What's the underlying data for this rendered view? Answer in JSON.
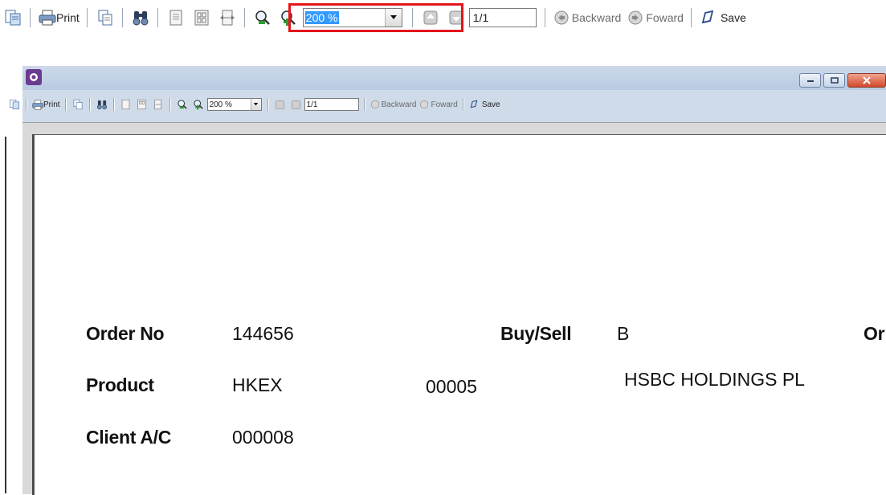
{
  "toolbar": {
    "print_label": "Print",
    "zoom": {
      "value": "200 %"
    },
    "page_indicator": "1/1",
    "backward_label": "Backward",
    "forward_label": "Foward",
    "save_label": "Save",
    "highlight_color": "#e4141b"
  },
  "inner_toolbar": {
    "print_label": "Print",
    "zoom": {
      "value": "200 %"
    },
    "page_indicator": "1/1",
    "backward_label": "Backward",
    "forward_label": "Foward",
    "save_label": "Save"
  },
  "icons": [
    "page-setup-icon",
    "print-icon",
    "copy-icon",
    "find-icon",
    "single-page-icon",
    "multi-page-icon",
    "page-width-icon",
    "zoom-out-icon",
    "zoom-in-icon",
    "prev-page-icon",
    "next-page-icon",
    "backward-icon",
    "forward-icon",
    "save-icon"
  ],
  "document": {
    "order_no": {
      "label": "Order No",
      "value": "144656"
    },
    "buy_sell": {
      "label": "Buy/Sell",
      "value": "B"
    },
    "order_cut": {
      "label": "Or"
    },
    "product": {
      "label": "Product",
      "exchange": "HKEX",
      "code": "00005",
      "name": "HSBC HOLDINGS PL"
    },
    "client_ac": {
      "label": "Client A/C",
      "value": "000008"
    }
  }
}
